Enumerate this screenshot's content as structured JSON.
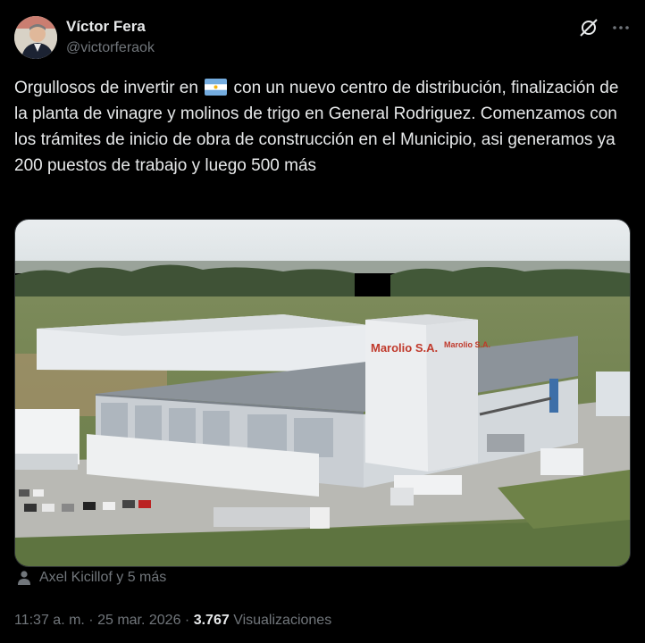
{
  "author": {
    "name": "Víctor Fera",
    "handle": "@victorferaok"
  },
  "tweet": {
    "text_before_flag": "Orgullosos de invertir en",
    "flag_icon": "argentina-flag",
    "text_after_flag": " con un nuevo centro de distribución, finalización de la planta de vinagre y molinos de trigo en General Rodriguez. Comenzamos con los trámites de inicio de obra de construcción en el Municipio, asi generamos ya 200 puestos de trabajo y luego 500 más"
  },
  "media": {
    "sign_main": "Marolio S.A.",
    "sign_side": "Marolio S.A."
  },
  "social_context": {
    "icon": "person-icon",
    "text": "Axel Kicillof y 5 más"
  },
  "meta": {
    "time": "11:37 a. m.",
    "separator": " · ",
    "date": "25 mar. 2026",
    "views_count": "3.767",
    "views_label": " Visualizaciones"
  },
  "colors": {
    "background": "#000000",
    "text": "#e7e9ea",
    "muted": "#71767b"
  }
}
